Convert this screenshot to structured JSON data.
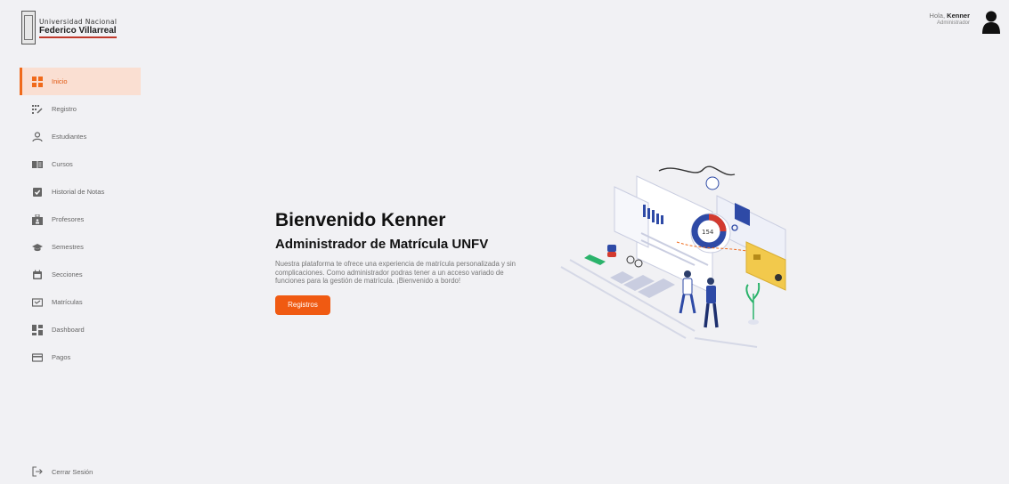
{
  "header": {
    "logo": {
      "line1": "Universidad Nacional",
      "line2": "Federico Villarreal"
    },
    "user": {
      "greeting": "Hola,",
      "name": "Kenner",
      "role": "Administrador",
      "icon": "user-icon"
    }
  },
  "sidebar": {
    "accent": "#f06a1a",
    "items": [
      {
        "label": "Inicio",
        "icon": "grid-icon",
        "active": true
      },
      {
        "label": "Registro",
        "icon": "register-icon"
      },
      {
        "label": "Estudiantes",
        "icon": "student-icon"
      },
      {
        "label": "Cursos",
        "icon": "book-icon"
      },
      {
        "label": "Historial de Notas",
        "icon": "check-square-icon"
      },
      {
        "label": "Profesores",
        "icon": "teacher-icon"
      },
      {
        "label": "Semestres",
        "icon": "graduation-cap-icon"
      },
      {
        "label": "Secciones",
        "icon": "calendar-icon"
      },
      {
        "label": "Matrículas",
        "icon": "enrollment-icon"
      },
      {
        "label": "Dashboard",
        "icon": "dashboard-icon"
      },
      {
        "label": "Pagos",
        "icon": "card-icon"
      }
    ],
    "logout": {
      "label": "Cerrar Sesión",
      "icon": "logout-icon"
    }
  },
  "main": {
    "title": "Bienvenido Kenner",
    "subtitle": "Administrador de Matrícula UNFV",
    "description": "Nuestra plataforma te ofrece una experiencia de matrícula personalizada y sin complicaciones. Como administrador podras tener a un acceso variado de funciones para la gestión de matrícula. ¡Bienvenido a bordo!",
    "cta_label": "Registros",
    "cta_color": "#f05a12",
    "illustration": {
      "donut_label": "154",
      "icon": "dashboard-illustration"
    }
  }
}
